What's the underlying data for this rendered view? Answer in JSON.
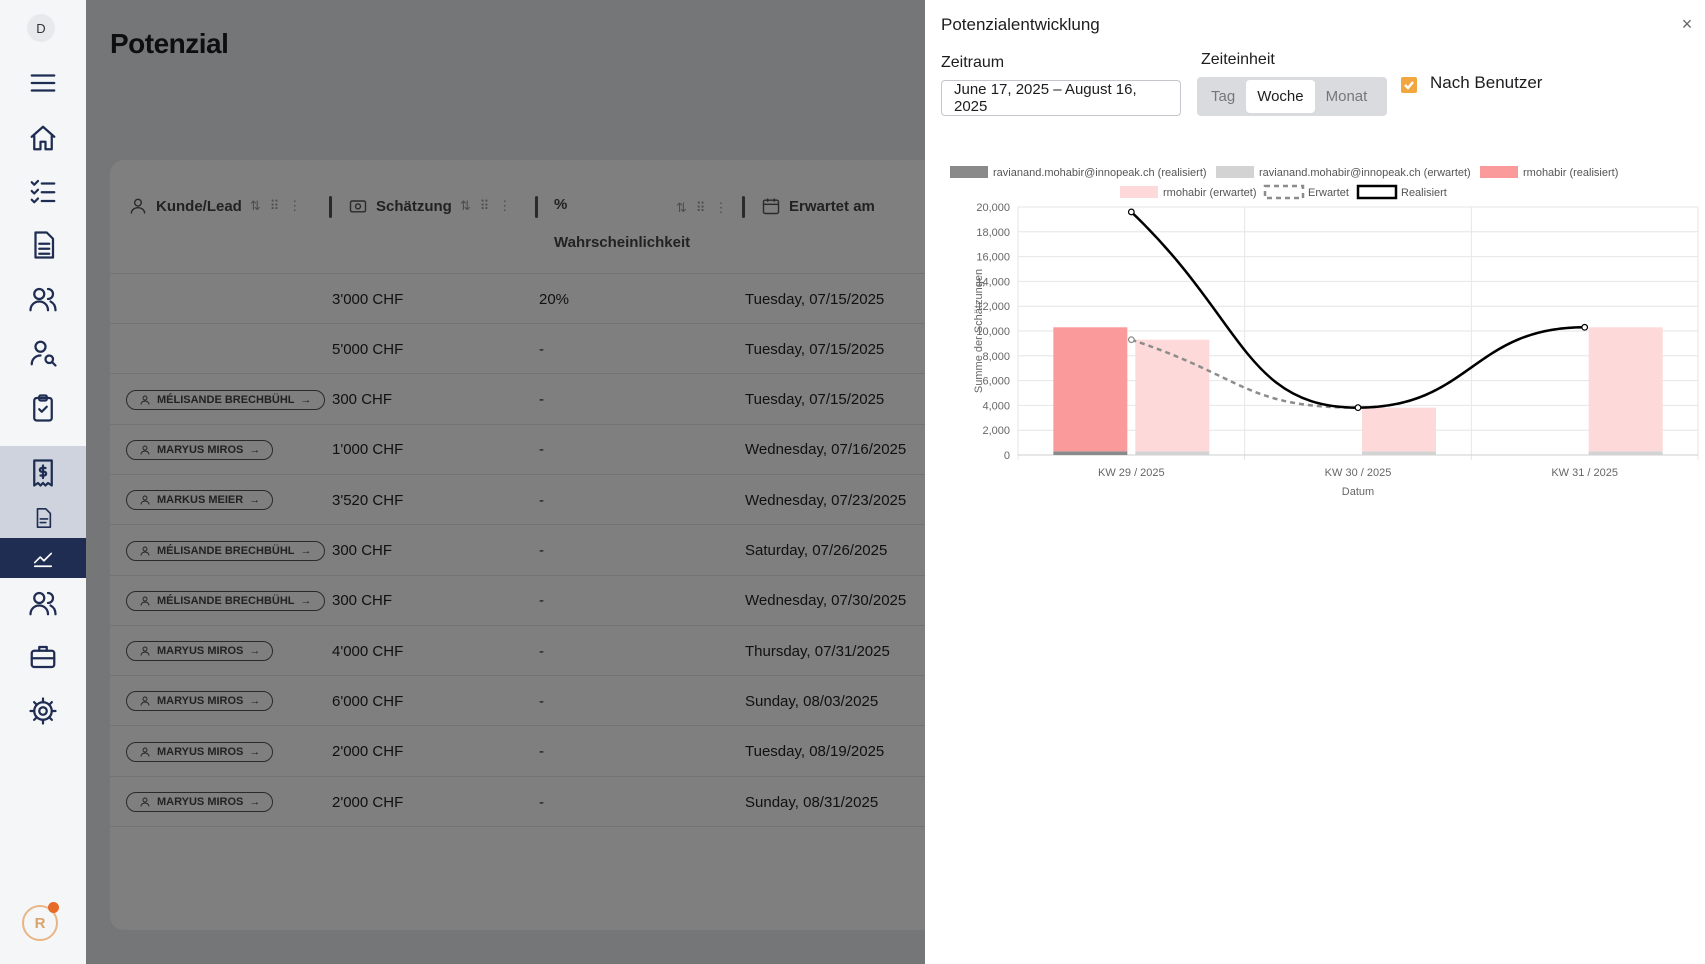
{
  "sidebar": {
    "user_initial": "D",
    "logo_letter": "R",
    "items": [
      {
        "name": "menu-icon"
      },
      {
        "name": "home-icon"
      },
      {
        "name": "tasks-icon"
      },
      {
        "name": "documents-icon"
      },
      {
        "name": "contacts-icon"
      },
      {
        "name": "user-search-icon"
      },
      {
        "name": "checklist-icon"
      },
      {
        "name": "receipt-icon"
      },
      {
        "name": "file-icon"
      },
      {
        "name": "chart-icon"
      },
      {
        "name": "team-icon"
      },
      {
        "name": "briefcase-icon"
      },
      {
        "name": "settings-icon"
      }
    ]
  },
  "main": {
    "title": "Potenzial",
    "columns": {
      "customer": "Kunde/Lead",
      "estimate": "Schätzung",
      "probability_icon": "%",
      "probability": "Wahrscheinlichkeit",
      "expected": "Erwartet am"
    },
    "rows": [
      {
        "customer": "",
        "estimate": "3'000 CHF",
        "probability": "20%",
        "date": "Tuesday, 07/15/2025"
      },
      {
        "customer": "",
        "estimate": "5'000 CHF",
        "probability": "-",
        "date": "Tuesday, 07/15/2025"
      },
      {
        "customer": "MÉLISANDE BRECHBÜHL",
        "estimate": "300 CHF",
        "probability": "-",
        "date": "Tuesday, 07/15/2025"
      },
      {
        "customer": "MARYUS MIROS",
        "estimate": "1'000 CHF",
        "probability": "-",
        "date": "Wednesday, 07/16/2025"
      },
      {
        "customer": "MARKUS MEIER",
        "estimate": "3'520 CHF",
        "probability": "-",
        "date": "Wednesday, 07/23/2025"
      },
      {
        "customer": "MÉLISANDE BRECHBÜHL",
        "estimate": "300 CHF",
        "probability": "-",
        "date": "Saturday, 07/26/2025"
      },
      {
        "customer": "MÉLISANDE BRECHBÜHL",
        "estimate": "300 CHF",
        "probability": "-",
        "date": "Wednesday, 07/30/2025"
      },
      {
        "customer": "MARYUS MIROS",
        "estimate": "4'000 CHF",
        "probability": "-",
        "date": "Thursday, 07/31/2025"
      },
      {
        "customer": "MARYUS MIROS",
        "estimate": "6'000 CHF",
        "probability": "-",
        "date": "Sunday, 08/03/2025"
      },
      {
        "customer": "MARYUS MIROS",
        "estimate": "2'000 CHF",
        "probability": "-",
        "date": "Tuesday, 08/19/2025"
      },
      {
        "customer": "MARYUS MIROS",
        "estimate": "2'000 CHF",
        "probability": "-",
        "date": "Sunday, 08/31/2025"
      }
    ]
  },
  "drawer": {
    "title": "Potenzialentwicklung",
    "close_symbol": "×",
    "period_label": "Zeitraum",
    "period_value": "June 17, 2025 – August 16, 2025",
    "unit_label": "Zeiteinheit",
    "units": [
      "Tag",
      "Woche",
      "Monat"
    ],
    "selected_unit": "Woche",
    "by_user_label": "Nach Benutzer",
    "by_user_checked": true
  },
  "colors": {
    "accent": "#f2a640",
    "nav_dark": "#1f2d52",
    "bar_realized_user1": "#8a8a8a",
    "bar_expected_user1": "#d3d3d3",
    "bar_realized_user2": "#fb9a9a",
    "bar_expected_user2": "#fdd9d9"
  },
  "chart_data": {
    "type": "bar",
    "categories": [
      "KW 29 / 2025",
      "KW 30 / 2025",
      "KW 31 / 2025"
    ],
    "xlabel": "Datum",
    "ylabel": "Summe der Schätzungen",
    "ylim": [
      0,
      20000
    ],
    "yticks": [
      "0",
      "2,000",
      "4,000",
      "6,000",
      "8,000",
      "10,000",
      "12,000",
      "14,000",
      "16,000",
      "18,000",
      "20,000"
    ],
    "grid": true,
    "legend_position": "top",
    "series": [
      {
        "name": "ravianand.mohabir@innopeak.ch (realisiert)",
        "kind": "bar",
        "stack": "realisiert",
        "color": "#8a8a8a",
        "values": [
          300,
          0,
          0
        ]
      },
      {
        "name": "ravianand.mohabir@innopeak.ch (erwartet)",
        "kind": "bar",
        "stack": "erwartet",
        "color": "#d3d3d3",
        "values": [
          300,
          300,
          300
        ]
      },
      {
        "name": "rmohabir (realisiert)",
        "kind": "bar",
        "stack": "realisiert",
        "color": "#fb9a9a",
        "values": [
          10000,
          0,
          0
        ]
      },
      {
        "name": "rmohabir (erwartet)",
        "kind": "bar",
        "stack": "erwartet",
        "color": "#fdd9d9",
        "values": [
          9000,
          3520,
          10000
        ]
      },
      {
        "name": "Erwartet",
        "kind": "line",
        "style": "dashed",
        "color": "#8c8c8c",
        "values": [
          9300,
          3820,
          10300
        ]
      },
      {
        "name": "Realisiert",
        "kind": "line",
        "style": "solid",
        "color": "#000000",
        "values": [
          19600,
          3820,
          10300
        ]
      }
    ]
  }
}
